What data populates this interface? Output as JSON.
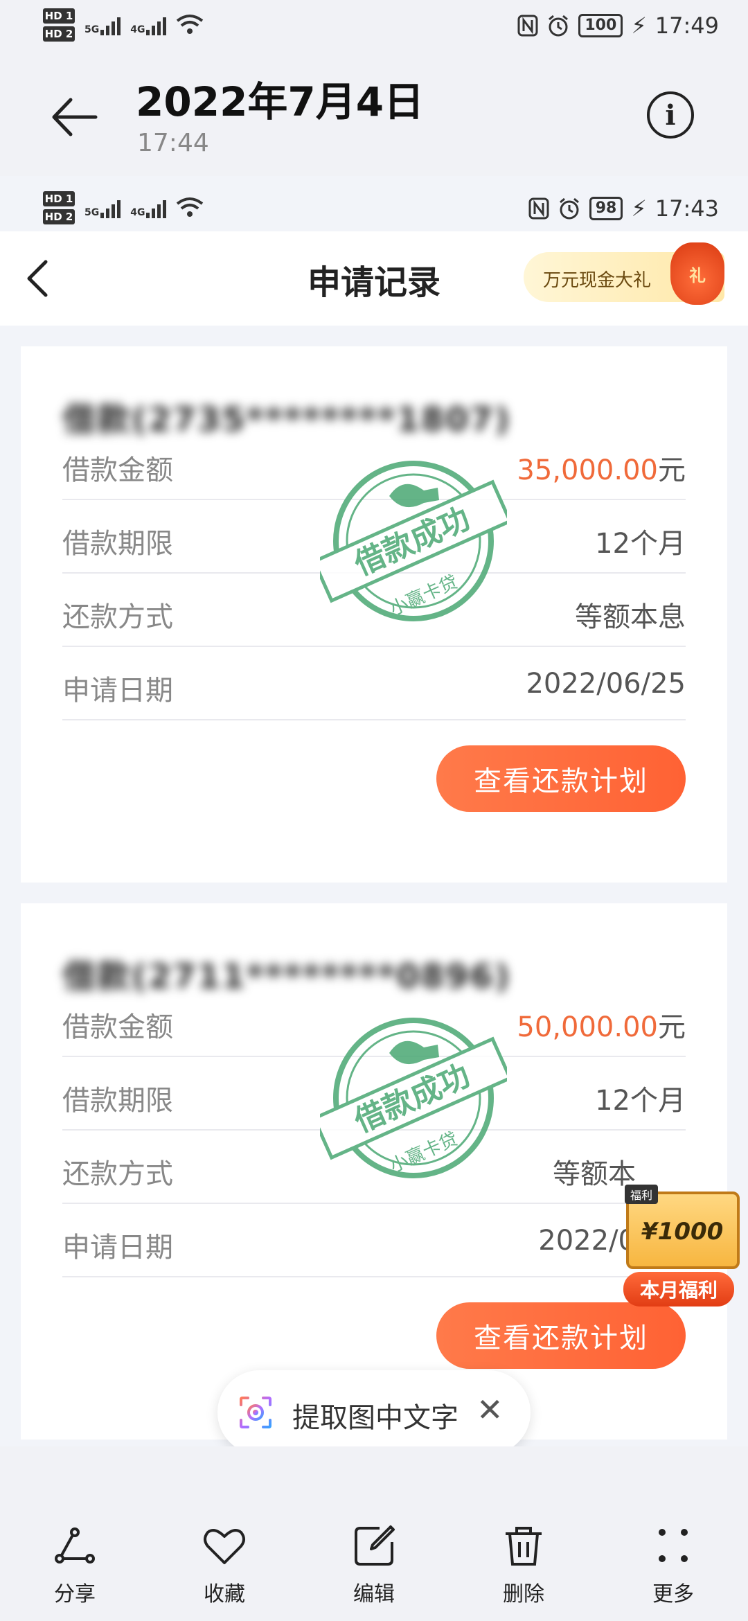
{
  "device_status": {
    "signal_1": "5G",
    "signal_2": "4G",
    "battery": "100",
    "time": "17:49"
  },
  "viewer": {
    "title": "2022年7月4日",
    "subtitle": "17:44"
  },
  "screenshot": {
    "status": {
      "signal_1": "5G",
      "signal_2": "4G",
      "battery": "98",
      "time": "17:43"
    },
    "app_title": "申请记录",
    "promo_label": "万元现金大礼",
    "promo_icon": "礼",
    "stamp_text": "借款成功",
    "stamp_sub": "小赢卡贷",
    "cards": [
      {
        "title": "借款(2735********1807)",
        "rows": [
          {
            "label": "借款金额",
            "amount": "35,000.00",
            "unit": "元"
          },
          {
            "label": "借款期限",
            "value": "12个月"
          },
          {
            "label": "还款方式",
            "value": "等额本息"
          },
          {
            "label": "申请日期",
            "value": "2022/06/25"
          }
        ],
        "button": "查看还款计划"
      },
      {
        "title": "借款(2711********0896)",
        "rows": [
          {
            "label": "借款金额",
            "amount": "50,000.00",
            "unit": "元"
          },
          {
            "label": "借款期限",
            "value": "12个月"
          },
          {
            "label": "还款方式",
            "value": "等额本"
          },
          {
            "label": "申请日期",
            "value": "2022/0"
          }
        ],
        "button": "查看还款计划"
      }
    ],
    "float_badge": {
      "tag": "福利",
      "amount": "¥1000",
      "label": "本月福利"
    }
  },
  "ocr": {
    "label": "提取图中文字",
    "close": "✕"
  },
  "toolbar": {
    "share": "分享",
    "favorite": "收藏",
    "edit": "编辑",
    "delete": "删除",
    "more": "更多"
  },
  "colors": {
    "accent": "#ff6a3c",
    "amount": "#f06a3a",
    "stamp": "#4aa873"
  }
}
